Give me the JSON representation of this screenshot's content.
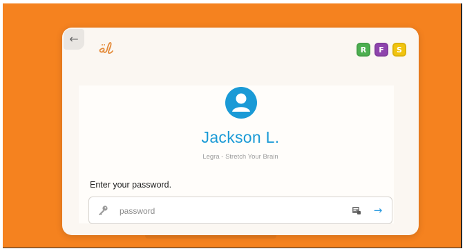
{
  "nav": {
    "back_icon": "←"
  },
  "brand": {
    "logo_icon": "el-logo-icon"
  },
  "badges": [
    {
      "letter": "R",
      "color": "#4caf50"
    },
    {
      "letter": "F",
      "color": "#8e44ad"
    },
    {
      "letter": "S",
      "color": "#f1c40f"
    }
  ],
  "user": {
    "avatar_icon": "user-avatar-icon",
    "name": "Jackson L.",
    "subtitle": "Legra - Stretch Your Brain"
  },
  "login": {
    "prompt": "Enter your password.",
    "password_placeholder": "password",
    "password_value": "",
    "submit_icon": "→"
  },
  "colors": {
    "background": "#f5821f",
    "accent": "#1a9ad6",
    "card": "#fbf7f2"
  }
}
